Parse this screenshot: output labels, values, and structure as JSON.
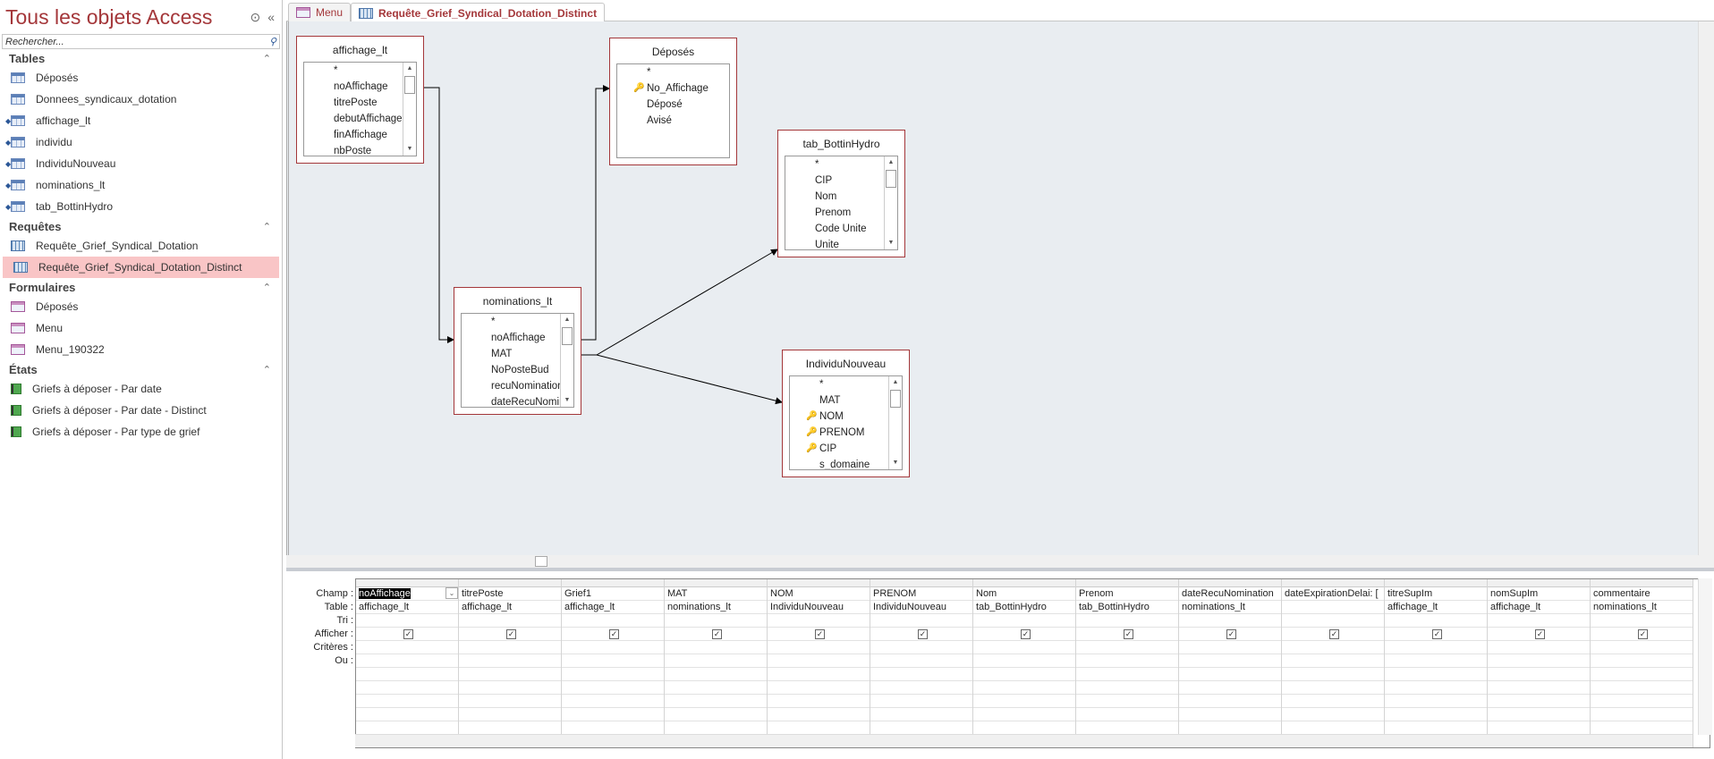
{
  "nav": {
    "title": "Tous les objets Access",
    "search_placeholder": "Rechercher...",
    "groups": [
      {
        "label": "Tables",
        "icon": "table-icon",
        "items": [
          {
            "label": "Déposés",
            "linked": false
          },
          {
            "label": "Donnees_syndicaux_dotation",
            "linked": false
          },
          {
            "label": "affichage_lt",
            "linked": true
          },
          {
            "label": "individu",
            "linked": true
          },
          {
            "label": "IndividuNouveau",
            "linked": true
          },
          {
            "label": "nominations_lt",
            "linked": true
          },
          {
            "label": "tab_BottinHydro",
            "linked": true
          }
        ]
      },
      {
        "label": "Requêtes",
        "icon": "query-icon",
        "items": [
          {
            "label": "Requête_Grief_Syndical_Dotation"
          },
          {
            "label": "Requête_Grief_Syndical_Dotation_Distinct",
            "selected": true
          }
        ]
      },
      {
        "label": "Formulaires",
        "icon": "form-icon",
        "items": [
          {
            "label": "Déposés"
          },
          {
            "label": "Menu"
          },
          {
            "label": "Menu_190322"
          }
        ]
      },
      {
        "label": "États",
        "icon": "report-icon",
        "items": [
          {
            "label": "Griefs à déposer - Par date"
          },
          {
            "label": "Griefs à déposer - Par date - Distinct"
          },
          {
            "label": "Griefs à déposer - Par type de grief"
          }
        ]
      }
    ]
  },
  "tabs": [
    {
      "label": "Menu",
      "icon": "form-icon"
    },
    {
      "label": "Requête_Grief_Syndical_Dotation_Distinct",
      "icon": "query-icon",
      "active": true
    }
  ],
  "tables": [
    {
      "name": "affichage_lt",
      "fields": [
        {
          "n": "*"
        },
        {
          "n": "noAffichage"
        },
        {
          "n": "titrePoste"
        },
        {
          "n": "debutAffichage"
        },
        {
          "n": "finAffichage"
        },
        {
          "n": "nbPoste"
        }
      ]
    },
    {
      "name": "Déposés",
      "fields": [
        {
          "n": "*"
        },
        {
          "n": "No_Affichage",
          "key": true
        },
        {
          "n": "Déposé"
        },
        {
          "n": "Avisé"
        }
      ],
      "noscroll": true
    },
    {
      "name": "tab_BottinHydro",
      "fields": [
        {
          "n": "*"
        },
        {
          "n": "CIP"
        },
        {
          "n": "Nom"
        },
        {
          "n": "Prenom"
        },
        {
          "n": "Code Unite"
        },
        {
          "n": "Unite"
        }
      ]
    },
    {
      "name": "nominations_lt",
      "fields": [
        {
          "n": "*"
        },
        {
          "n": "noAffichage"
        },
        {
          "n": "MAT"
        },
        {
          "n": "NoPosteBud"
        },
        {
          "n": "recuNomination"
        },
        {
          "n": "dateRecuNomination"
        }
      ]
    },
    {
      "name": "IndividuNouveau",
      "fields": [
        {
          "n": "*"
        },
        {
          "n": "MAT"
        },
        {
          "n": "NOM",
          "key": true
        },
        {
          "n": "PRENOM",
          "key": true
        },
        {
          "n": "CIP",
          "key": true
        },
        {
          "n": "s_domaine"
        }
      ]
    }
  ],
  "grid": {
    "row_labels": [
      "Champ :",
      "Table :",
      "Tri :",
      "Afficher :",
      "Critères :",
      "Ou :"
    ],
    "columns": [
      {
        "field": "noAffichage",
        "table": "affichage_lt",
        "show": true
      },
      {
        "field": "titrePoste",
        "table": "affichage_lt",
        "show": true
      },
      {
        "field": "Grief1",
        "table": "affichage_lt",
        "show": true
      },
      {
        "field": "MAT",
        "table": "nominations_lt",
        "show": true
      },
      {
        "field": "NOM",
        "table": "IndividuNouveau",
        "show": true
      },
      {
        "field": "PRENOM",
        "table": "IndividuNouveau",
        "show": true
      },
      {
        "field": "Nom",
        "table": "tab_BottinHydro",
        "show": true
      },
      {
        "field": "Prenom",
        "table": "tab_BottinHydro",
        "show": true
      },
      {
        "field": "dateRecuNomination",
        "table": "nominations_lt",
        "show": true
      },
      {
        "field": "dateExpirationDelai: [",
        "table": "",
        "show": true
      },
      {
        "field": "titreSupIm",
        "table": "affichage_lt",
        "show": true
      },
      {
        "field": "nomSupIm",
        "table": "affichage_lt",
        "show": true
      },
      {
        "field": "commentaire",
        "table": "nominations_lt",
        "show": true
      }
    ]
  },
  "colors": {
    "accent": "#a4373a",
    "selected_bg": "#f9c5c6",
    "design_bg": "#e9edf1"
  }
}
